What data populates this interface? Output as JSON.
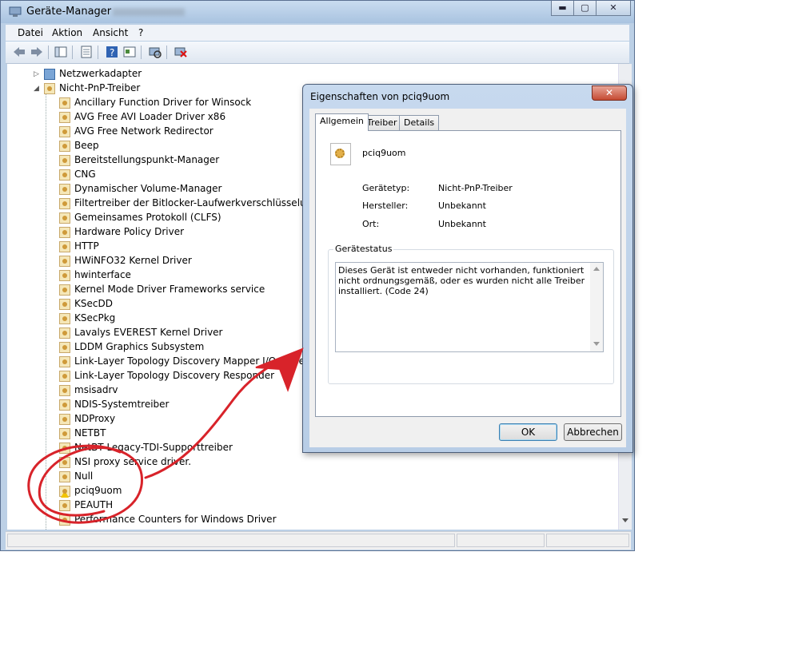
{
  "window": {
    "title": "Geräte-Manager",
    "minimize": "▬",
    "maximize": "▢",
    "close": "✕"
  },
  "menu": [
    "Datei",
    "Aktion",
    "Ansicht",
    "?"
  ],
  "toolbar_icons": [
    "back-icon",
    "forward-icon",
    "properties-pane-icon",
    "view-icon",
    "help-icon",
    "update-driver-icon",
    "scan-hardware-icon",
    "uninstall-icon"
  ],
  "tree": {
    "parent_collapsed": "Netzwerkadapter",
    "parent_expanded": "Nicht-PnP-Treiber",
    "children": [
      "Ancillary Function Driver for Winsock",
      "AVG Free AVI Loader Driver x86",
      "AVG Free Network Redirector",
      "Beep",
      "Bereitstellungspunkt-Manager",
      "CNG",
      "Dynamischer Volume-Manager",
      "Filtertreiber der Bitlocker-Laufwerkverschlüsselung",
      "Gemeinsames Protokoll (CLFS)",
      "Hardware Policy Driver",
      "HTTP",
      "HWiNFO32 Kernel Driver",
      "hwinterface",
      "Kernel Mode Driver Frameworks service",
      "KSecDD",
      "KSecPkg",
      "Lavalys EVEREST Kernel Driver",
      "LDDM Graphics Subsystem",
      "Link-Layer Topology Discovery Mapper I/O Driver",
      "Link-Layer Topology Discovery Responder",
      "msisadrv",
      "NDIS-Systemtreiber",
      "NDProxy",
      "NETBT",
      "NetBT Legacy-TDI-Supporttreiber",
      "NSI proxy service driver.",
      "Null",
      "pciq9uom",
      "PEAUTH",
      "Performance Counters for Windows Driver"
    ],
    "warning_item": "pciq9uom"
  },
  "dialog": {
    "title": "Eigenschaften von pciq9uom",
    "close": "✕",
    "tabs": [
      "Allgemein",
      "Treiber",
      "Details"
    ],
    "device_name": "pciq9uom",
    "fields": [
      {
        "label": "Gerätetyp:",
        "value": "Nicht-PnP-Treiber"
      },
      {
        "label": "Hersteller:",
        "value": "Unbekannt"
      },
      {
        "label": "Ort:",
        "value": "Unbekannt"
      }
    ],
    "status_group": "Gerätestatus",
    "status_text": "Dieses Gerät ist entweder nicht vorhanden, funktioniert nicht ordnungsgemäß, oder es wurden nicht alle Treiber installiert. (Code 24)",
    "ok": "OK",
    "cancel": "Abbrechen"
  },
  "annotation_color": "#d8232a"
}
